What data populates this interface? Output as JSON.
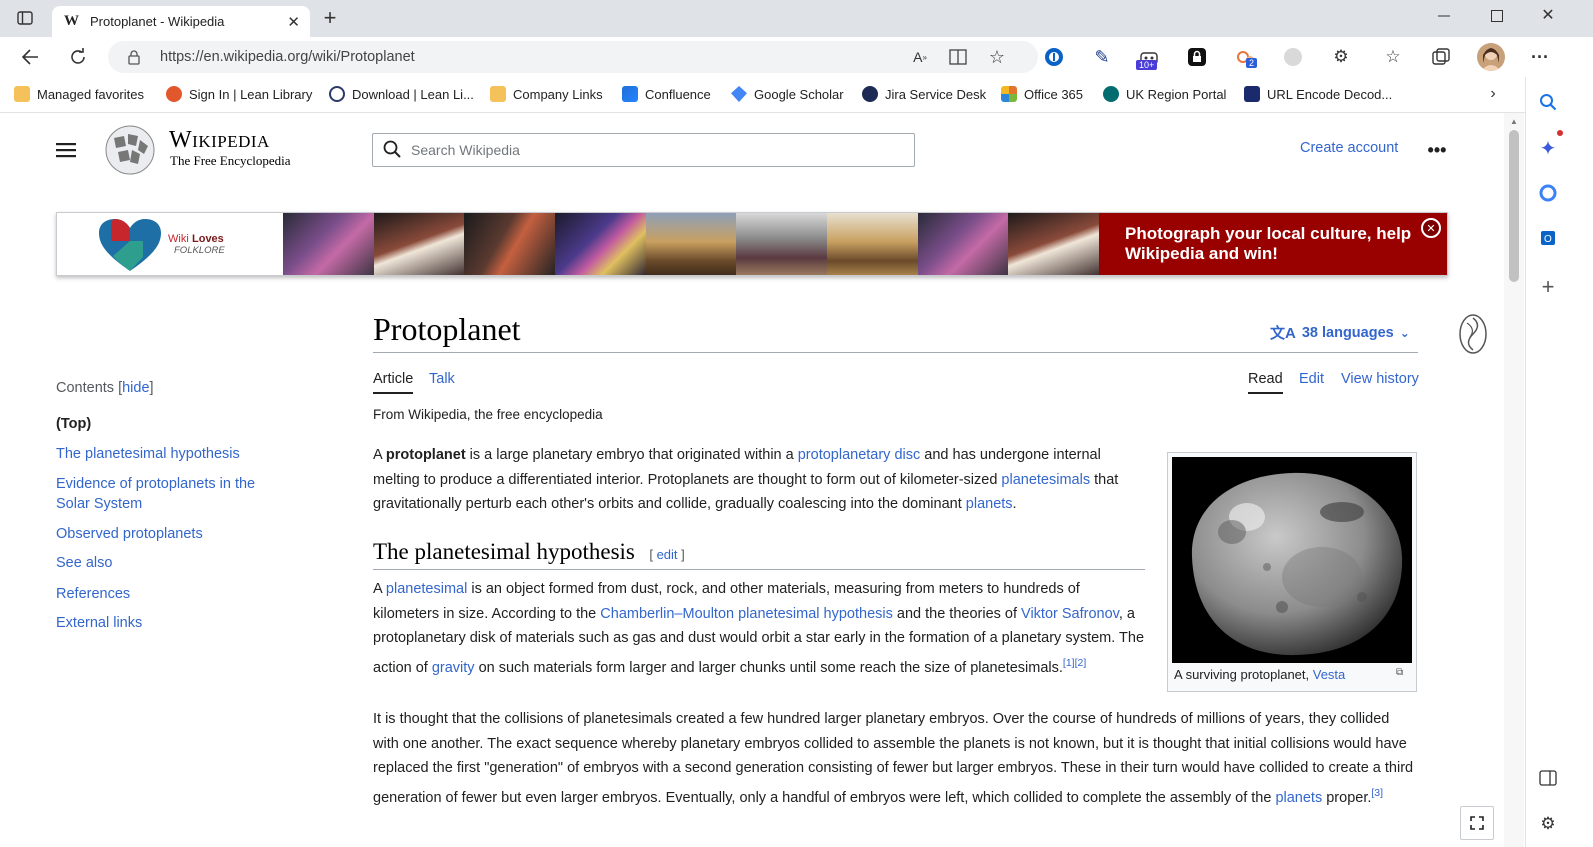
{
  "browser": {
    "tab_title": "Protoplanet - Wikipedia",
    "url": "https://en.wikipedia.org/wiki/Protoplanet",
    "favorites": [
      {
        "label": "Managed favorites",
        "color": "#f4c15b"
      },
      {
        "label": "Sign In | Lean Library",
        "color": "#e2582c"
      },
      {
        "label": "Download | Lean Li...",
        "color": "#2b3a67"
      },
      {
        "label": "Company Links",
        "color": "#f4c15b"
      },
      {
        "label": "Confluence",
        "color": "#1f6fd8"
      },
      {
        "label": "Google Scholar",
        "color": "#4285f4"
      },
      {
        "label": "Jira Service Desk",
        "color": "#1d2a54"
      },
      {
        "label": "Office 365",
        "color": "#e3742e"
      },
      {
        "label": "UK Region Portal",
        "color": "#036c70"
      },
      {
        "label": "URL Encode Decod...",
        "color": "#1a2a6c"
      }
    ],
    "ext_badges": {
      "robot": "10+",
      "stack": "2"
    }
  },
  "wiki": {
    "logo_title": "Wikipedia",
    "logo_subtitle": "The Free Encyclopedia",
    "search_placeholder": "Search Wikipedia",
    "create_account": "Create account",
    "banner": {
      "logo_wiki": "Wiki",
      "logo_loves": "Loves",
      "logo_folklore": "FOLKLORE",
      "message": "Photograph your local culture, help Wikipedia and win!"
    },
    "title": "Protoplanet",
    "languages": "38 languages",
    "tabs": {
      "article": "Article",
      "talk": "Talk",
      "read": "Read",
      "edit": "Edit",
      "history": "View history"
    },
    "tagline": "From Wikipedia, the free encyclopedia",
    "toc": {
      "heading": "Contents",
      "hide": "hide",
      "items": [
        "(Top)",
        "The planetesimal hypothesis",
        "Evidence of protoplanets in the Solar System",
        "Observed protoplanets",
        "See also",
        "References",
        "External links"
      ]
    },
    "intro": {
      "a1": "A ",
      "bold": "protoplanet",
      "a2": " is a large planetary embryo that originated within a ",
      "l1": "protoplanetary disc",
      "a3": " and has undergone internal melting to produce a differentiated interior. Protoplanets are thought to form out of kilometer-sized ",
      "l2": "planetesimals",
      "a4": " that gravitationally perturb each other's orbits and collide, gradually coalescing into the dominant ",
      "l3": "planets",
      "a5": "."
    },
    "section1": {
      "heading": "The planetesimal hypothesis",
      "edit": "edit"
    },
    "p1": {
      "a1": "A ",
      "l1": "planetesimal",
      "a2": " is an object formed from dust, rock, and other materials, measuring from meters to hundreds of kilometers in size. According to the ",
      "l2": "Chamberlin–Moulton planetesimal hypothesis",
      "a3": " and the theories of ",
      "l3": "Viktor Safronov",
      "a4": ", a protoplanetary disk of materials such as gas and dust would orbit a star early in the formation of a planetary system. The action of ",
      "l4": "gravity",
      "a5": " on such materials form larger and larger chunks until some reach the size of planetesimals.",
      "ref": "[1][2]"
    },
    "p2": {
      "a1": "It is thought that the collisions of planetesimals created a few hundred larger planetary embryos. Over the course of hundreds of millions of years, they collided with one another. The exact sequence whereby planetary embryos collided to assemble the planets is not known, but it is thought that initial collisions would have replaced the first \"generation\" of embryos with a second generation consisting of fewer but larger embryos. These in their turn would have collided to create a third generation of fewer but even larger embryos. Eventually, only a handful of embryos were left, which collided to complete the assembly of the ",
      "l1": "planets",
      "a2": " proper.",
      "ref": "[3]"
    },
    "infobox": {
      "caption": "A surviving protoplanet, ",
      "caption_link": "Vesta"
    }
  }
}
